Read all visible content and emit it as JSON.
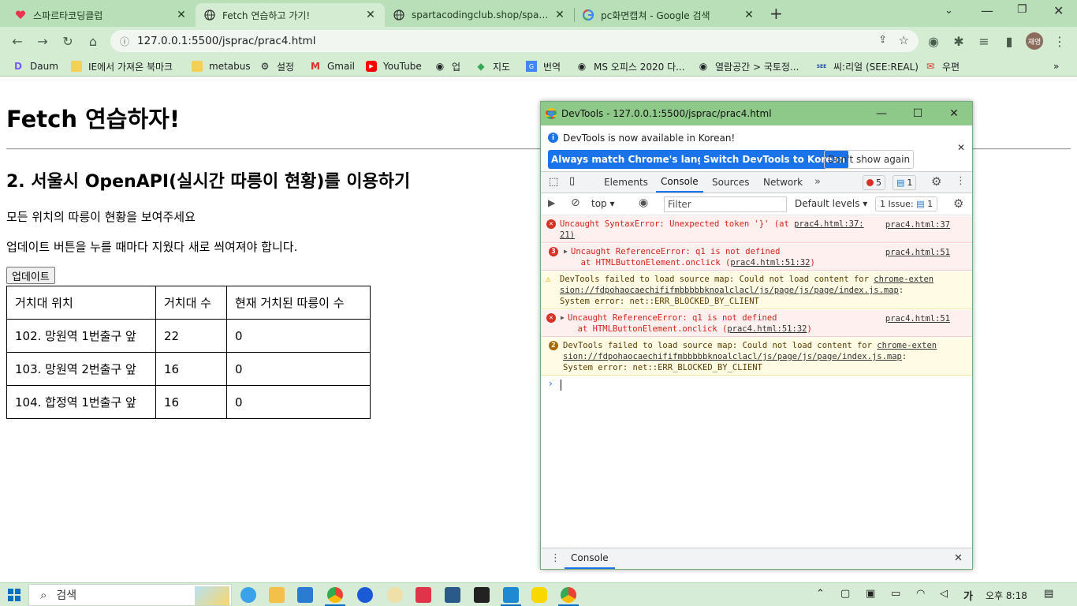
{
  "browser": {
    "tabs": [
      {
        "title": "스파르타코딩클럽",
        "active": false
      },
      {
        "title": "Fetch 연습하고 가기!",
        "active": true
      },
      {
        "title": "spartacodingclub.shop/sparta_a",
        "active": false
      },
      {
        "title": "pc화면캡쳐 - Google 검색",
        "active": false
      }
    ],
    "url": "127.0.0.1:5500/jsprac/prac4.html",
    "profile": "재영",
    "bookmarks": [
      "Daum",
      "IE에서 가져온 북마크",
      "metabus",
      "설정",
      "Gmail",
      "YouTube",
      "업",
      "지도",
      "번역",
      "MS 오피스 2020 다...",
      "열람공간 > 국토정...",
      "씨:리얼 (SEE:REAL)",
      "우편"
    ]
  },
  "page": {
    "title": "Fetch 연습하자!",
    "subtitle": "2. 서울시 OpenAPI(실시간 따릉이 현황)를 이용하기",
    "desc1": "모든 위치의 따릉이 현황을 보여주세요",
    "desc2": "업데이트 버튼을 누를 때마다 지웠다 새로 씌여져야 합니다.",
    "update_button": "업데이트",
    "table": {
      "headers": [
        "거치대 위치",
        "거치대 수",
        "현재 거치된 따릉이 수"
      ],
      "rows": [
        [
          "102. 망원역 1번출구 앞",
          "22",
          "0"
        ],
        [
          "103. 망원역 2번출구 앞",
          "16",
          "0"
        ],
        [
          "104. 합정역 1번출구 앞",
          "16",
          "0"
        ]
      ]
    }
  },
  "devtools": {
    "window_title": "DevTools - 127.0.0.1:5500/jsprac/prac4.html",
    "info": "DevTools is now available in Korean!",
    "btn_match": "Always match Chrome's language",
    "btn_switch": "Switch DevTools to Korean",
    "btn_dont": "Don't show again",
    "tabs": [
      "Elements",
      "Console",
      "Sources",
      "Network"
    ],
    "active_tab": "Console",
    "errors_count": "5",
    "messages_count": "1",
    "context": "top",
    "filter_placeholder": "Filter",
    "levels": "Default levels",
    "issues": "1 Issue:",
    "issues_count": "1",
    "console": [
      {
        "type": "error",
        "text1": "Uncaught SyntaxError: Unexpected token '}' (at ",
        "link1": "prac4.html:37:",
        "right": "prac4.html:37",
        "text2": "21)"
      },
      {
        "type": "error",
        "count": "3",
        "text1": "Uncaught ReferenceError: q1 is not defined",
        "text2": "at HTMLButtonElement.onclick (",
        "link2": "prac4.html:51:32",
        "right": "prac4.html:51"
      },
      {
        "type": "warning",
        "text1": "DevTools failed to load source map: Could not load content for ",
        "link1": "chrome-exten",
        "link1b": "sion://fdpohaocaechififmbbbbbknoalclacl/js/page/js/page/index.js.map",
        "text2": "System error: net::ERR_BLOCKED_BY_CLIENT"
      },
      {
        "type": "error",
        "text1": "Uncaught ReferenceError: q1 is not defined",
        "text2": "at HTMLButtonElement.onclick (",
        "link2": "prac4.html:51:32",
        "right": "prac4.html:51"
      },
      {
        "type": "warning",
        "count": "2",
        "text1": "DevTools failed to load source map: Could not load content for ",
        "link1": "chrome-exten",
        "link1b": "sion://fdpohaocaechififmbbbbbknoalclacl/js/page/js/page/index.js.map",
        "text2": "System error: net::ERR_BLOCKED_BY_CLIENT"
      }
    ],
    "drawer_tab": "Console"
  },
  "taskbar": {
    "search_placeholder": "검색",
    "ime": "가",
    "time": "오후 8:18"
  },
  "colors": {
    "chrome_tabstrip": "#b8dfb8",
    "chrome_toolbar": "#d3ecd2",
    "devtools_title": "#8fc98a",
    "error_red": "#d3241a",
    "accent_blue": "#1a73e8"
  }
}
